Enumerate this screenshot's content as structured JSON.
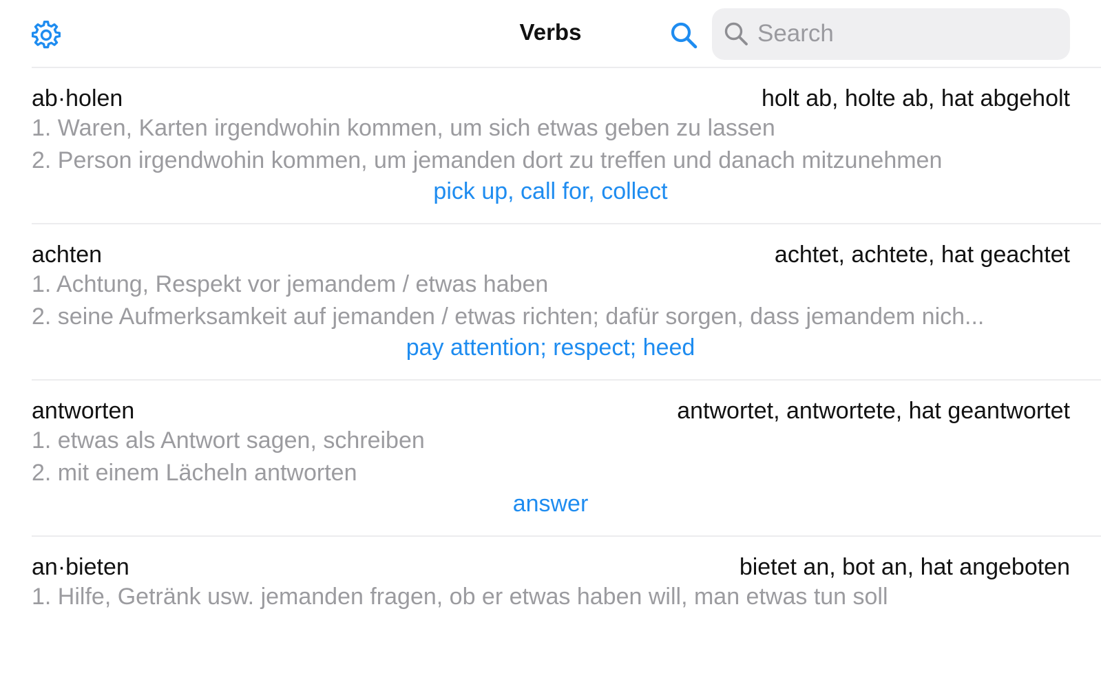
{
  "header": {
    "title": "Verbs",
    "settings_icon": "gear-icon",
    "search_icon": "magnifier-icon",
    "search_placeholder": "Search",
    "accent_color": "#1e8cf0"
  },
  "entries": [
    {
      "headword": "ab·holen",
      "forms": "holt ab, holte ab, hat abgeholt",
      "definitions": [
        "1. Waren, Karten irgendwohin kommen, um sich etwas geben zu lassen",
        "2. Person irgendwohin kommen, um jemanden dort zu treffen und danach mitzunehmen"
      ],
      "translation": "pick up, call for, collect"
    },
    {
      "headword": "achten",
      "forms": "achtet, achtete, hat geachtet",
      "definitions": [
        "1. Achtung, Respekt vor jemandem / etwas haben",
        "2. seine Aufmerksamkeit auf jemanden / etwas richten; dafür sorgen, dass jemandem nich..."
      ],
      "translation": "pay attention; respect; heed"
    },
    {
      "headword": "antworten",
      "forms": "antwortet, antwortete, hat geantwortet",
      "definitions": [
        "1. etwas als Antwort sagen, schreiben",
        "2. mit einem Lächeln antworten"
      ],
      "translation": "answer"
    },
    {
      "headword": "an·bieten",
      "forms": "bietet an, bot an, hat angeboten",
      "definitions": [
        "1. Hilfe, Getränk usw. jemanden fragen, ob er etwas haben will, man etwas tun soll"
      ],
      "translation": ""
    }
  ]
}
